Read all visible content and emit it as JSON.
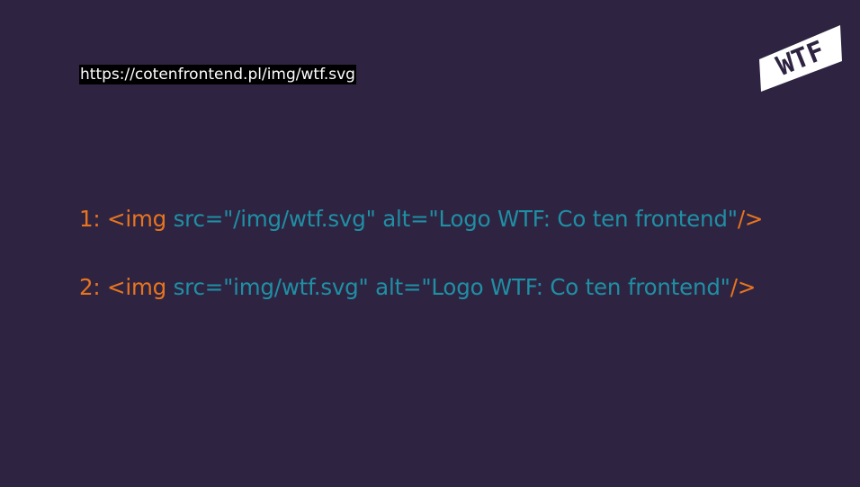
{
  "url_label": "https://cotenfrontend.pl/img/wtf.svg",
  "logo": {
    "text": "WTF",
    "icon": "wtf-logo",
    "background": "#ffffff",
    "foreground": "#2e2442"
  },
  "code_lines": [
    {
      "number": "1:",
      "tag_open": "<img",
      "attrs": "src=\"/img/wtf.svg\" alt=\"Logo WTF: Co ten frontend\"",
      "tag_close": "/>"
    },
    {
      "number": "2:",
      "tag_open": "<img",
      "attrs": "src=\"img/wtf.svg\" alt=\"Logo WTF: Co ten frontend\"",
      "tag_close": "/>"
    }
  ],
  "colors": {
    "background": "#2e2442",
    "orange": "#e8741e",
    "teal": "#1f8fa4"
  }
}
